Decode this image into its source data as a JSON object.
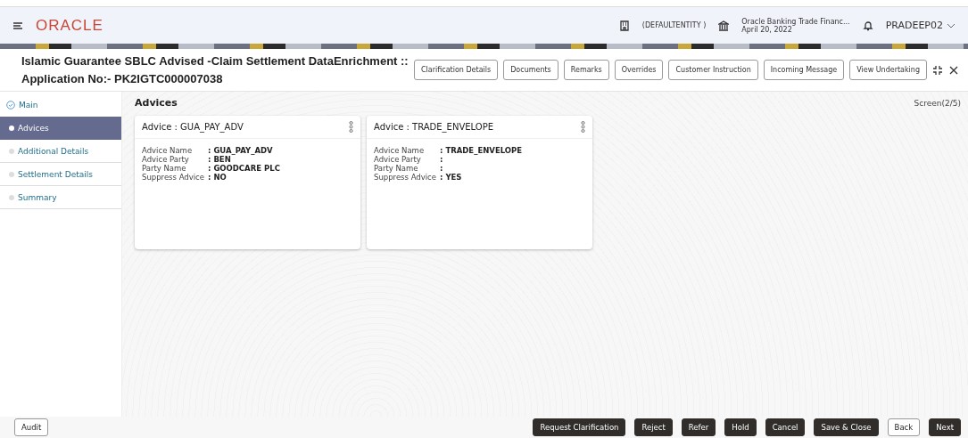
{
  "header": {
    "logo": "ORACLE",
    "entity": "(DEFAULTENTITY )",
    "branch": "Oracle Banking Trade Financ...",
    "date": "April 20, 2022",
    "user": "PRADEEP02"
  },
  "title": {
    "line1": "Islamic Guarantee SBLC Advised -Claim Settlement DataEnrichment ::",
    "line2": "Application No:- PK2IGTC000007038"
  },
  "actions": [
    "Clarification Details",
    "Documents",
    "Remarks",
    "Overrides",
    "Customer Instruction",
    "Incoming Message",
    "View Undertaking"
  ],
  "steps": [
    {
      "label": "Main",
      "selected": false,
      "completed": true
    },
    {
      "label": "Advices",
      "selected": true,
      "completed": false
    },
    {
      "label": "Additional Details",
      "selected": false,
      "completed": false
    },
    {
      "label": "Settlement Details",
      "selected": false,
      "completed": false
    },
    {
      "label": "Summary",
      "selected": false,
      "completed": false
    }
  ],
  "section": {
    "title": "Advices",
    "screen": "Screen(2/5)"
  },
  "cards": [
    {
      "title": "Advice : GUA_PAY_ADV",
      "fields": [
        {
          "label": "Advice Name",
          "value": ": GUA_PAY_ADV"
        },
        {
          "label": "Advice Party",
          "value": ": BEN"
        },
        {
          "label": "Party Name",
          "value": ": GOODCARE PLC"
        },
        {
          "label": "Suppress Advice",
          "value": ": NO"
        }
      ]
    },
    {
      "title": "Advice : TRADE_ENVELOPE",
      "fields": [
        {
          "label": "Advice Name",
          "value": ": TRADE_ENVELOPE"
        },
        {
          "label": "Advice Party",
          "value": ":"
        },
        {
          "label": "Party Name",
          "value": ":"
        },
        {
          "label": "Suppress Advice",
          "value": ": YES"
        }
      ]
    }
  ],
  "footer": {
    "audit": "Audit",
    "buttons": [
      {
        "label": "Request Clarification",
        "kind": "primary"
      },
      {
        "label": "Reject",
        "kind": "primary"
      },
      {
        "label": "Refer",
        "kind": "primary"
      },
      {
        "label": "Hold",
        "kind": "primary"
      },
      {
        "label": "Cancel",
        "kind": "primary"
      },
      {
        "label": "Save & Close",
        "kind": "primary"
      },
      {
        "label": "Back",
        "kind": "secondary"
      },
      {
        "label": "Next",
        "kind": "primary"
      }
    ]
  }
}
